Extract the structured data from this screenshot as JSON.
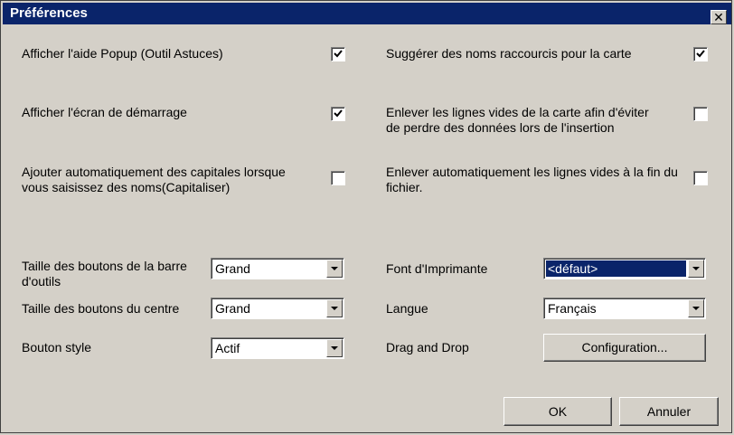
{
  "window": {
    "title": "Préférences",
    "close_symbol": "✕"
  },
  "options": [
    {
      "label": "Afficher l'aide Popup (Outil Astuces)",
      "checked": true
    },
    {
      "label": "Afficher l'écran de démarrage",
      "checked": true
    },
    {
      "label": "Ajouter automatiquement des capitales lorsque vous saisissez des noms(Capitaliser)",
      "checked": false
    },
    {
      "label": "Suggérer des noms raccourcis pour la carte",
      "checked": true
    },
    {
      "label": "Enlever les lignes vides de la carte afin d'éviter de perdre des données lors de l'insertion",
      "checked": false
    },
    {
      "label": "Enlever automatiquement les lignes vides à la fin du fichier.",
      "checked": false
    }
  ],
  "settings": {
    "toolbar_size": {
      "label": "Taille des boutons de la barre d'outils",
      "value": "Grand"
    },
    "center_size": {
      "label": "Taille des boutons du centre",
      "value": "Grand"
    },
    "button_style": {
      "label": "Bouton style",
      "value": "Actif"
    },
    "printer_font": {
      "label": "Font d'Imprimante",
      "value": "<défaut>"
    },
    "language": {
      "label": "Langue",
      "value": "Français"
    },
    "drag_drop": {
      "label": "Drag and Drop",
      "button": "Configuration..."
    }
  },
  "footer": {
    "ok": "OK",
    "cancel": "Annuler"
  },
  "colors": {
    "titlebar": "#0a246a",
    "face": "#d4d0c8",
    "selection": "#0a246a"
  },
  "icons": {
    "close": "close-icon",
    "check": "checkmark-icon",
    "dropdown": "chevron-down-icon"
  }
}
